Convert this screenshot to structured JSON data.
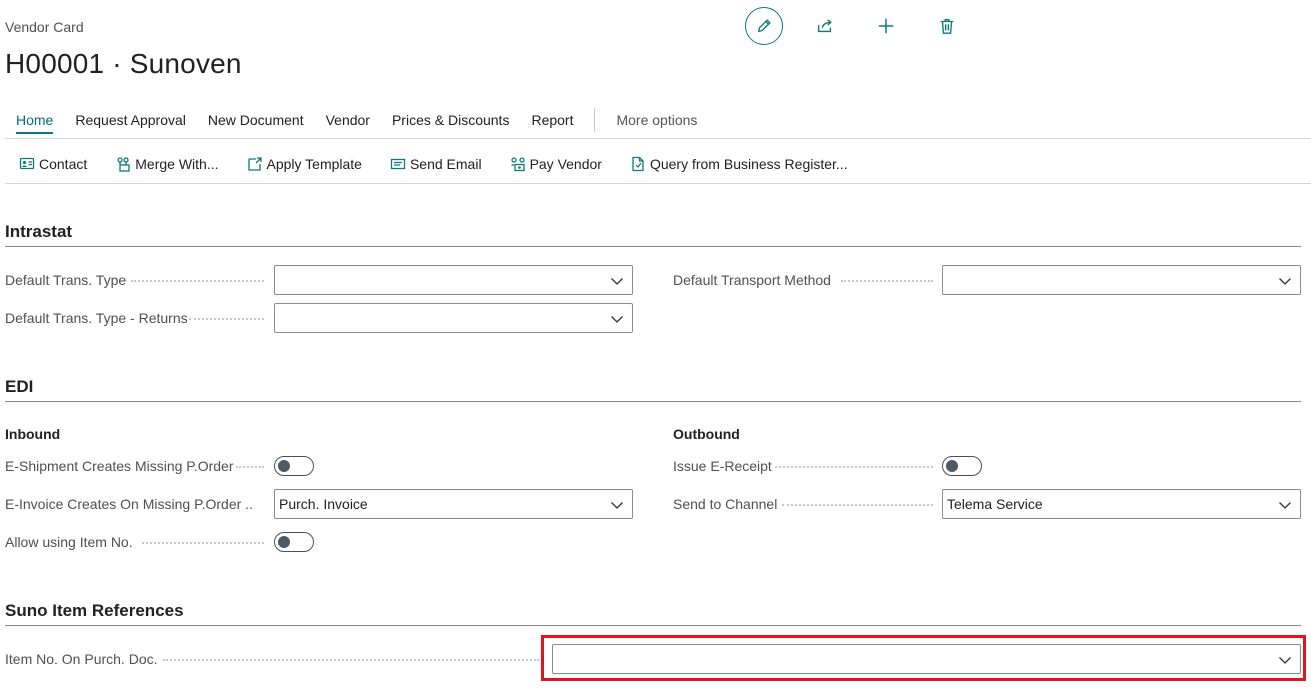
{
  "page": {
    "breadcrumb": "Vendor Card",
    "title": "H00001 · Sunoven"
  },
  "header_actions": [
    {
      "name": "edit",
      "icon": "pencil-icon"
    },
    {
      "name": "share",
      "icon": "share-icon"
    },
    {
      "name": "new",
      "icon": "plus-icon"
    },
    {
      "name": "delete",
      "icon": "trash-icon"
    }
  ],
  "nav": {
    "items": [
      "Home",
      "Request Approval",
      "New Document",
      "Vendor",
      "Prices & Discounts",
      "Report"
    ],
    "more": "More options",
    "active": "Home"
  },
  "toolbar": {
    "items": [
      {
        "label": "Contact",
        "icon": "contact-card-icon"
      },
      {
        "label": "Merge With...",
        "icon": "merge-icon"
      },
      {
        "label": "Apply Template",
        "icon": "apply-template-icon"
      },
      {
        "label": "Send Email",
        "icon": "email-icon"
      },
      {
        "label": "Pay Vendor",
        "icon": "pay-vendor-icon"
      },
      {
        "label": "Query from Business Register...",
        "icon": "document-query-icon"
      }
    ]
  },
  "intrastat": {
    "title": "Intrastat",
    "default_trans_type": {
      "label": "Default Trans. Type",
      "value": ""
    },
    "default_trans_type_returns": {
      "label": "Default Trans. Type - Returns",
      "value": ""
    },
    "default_transport_method": {
      "label": "Default Transport Method",
      "value": ""
    }
  },
  "edi": {
    "title": "EDI",
    "inbound": {
      "title": "Inbound",
      "eshipment": {
        "label": "E-Shipment Creates Missing P.Order",
        "on": false
      },
      "einvoice": {
        "label": "E-Invoice Creates On Missing P.Order ...",
        "value": "Purch. Invoice"
      },
      "allow_item_no": {
        "label": "Allow using Item No.",
        "on": false
      }
    },
    "outbound": {
      "title": "Outbound",
      "issue_ereceipt": {
        "label": "Issue E-Receipt",
        "on": false
      },
      "send_to_channel": {
        "label": "Send to Channel",
        "value": "Telema Service"
      }
    }
  },
  "suno": {
    "title": "Suno Item References",
    "item_no_on_purch_doc": {
      "label": "Item No. On Purch. Doc.",
      "value": ""
    }
  },
  "colors": {
    "accent": "#0b7a7a",
    "highlight": "#e0141e"
  }
}
